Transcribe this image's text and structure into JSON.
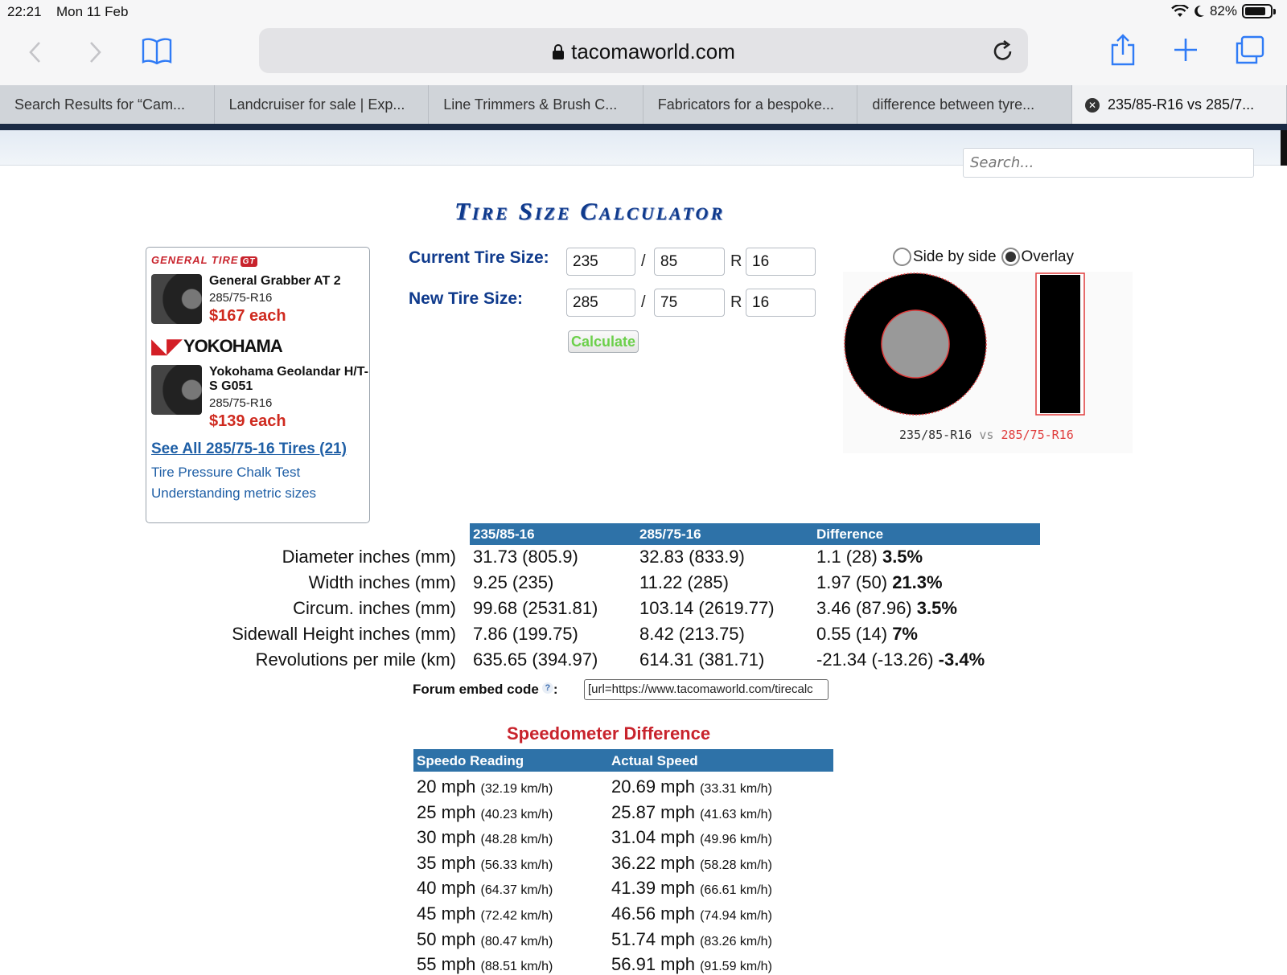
{
  "status": {
    "time": "22:21",
    "date": "Mon 11 Feb",
    "battery": "82%",
    "battery_level": 0.82
  },
  "toolbar": {
    "url": "tacomaworld.com",
    "back_icon": "chevron-left",
    "forward_icon": "chevron-right",
    "bookmarks_icon": "book",
    "share_icon": "share",
    "add_icon": "plus",
    "tabs_icon": "tabs",
    "reload_icon": "reload"
  },
  "tabs": [
    {
      "label": "Search Results for “Cam..."
    },
    {
      "label": "Landcruiser for sale | Exp..."
    },
    {
      "label": "Line Trimmers & Brush C..."
    },
    {
      "label": "Fabricators for a bespoke..."
    },
    {
      "label": "difference between tyre..."
    },
    {
      "label": "235/85-R16 vs 285/7..."
    }
  ],
  "search": {
    "placeholder": "Search..."
  },
  "page": {
    "title": "Tire Size Calculator"
  },
  "ad": {
    "brand1": "GENERAL TIRE",
    "brand1_badge": "GT",
    "tire1": {
      "name": "General Grabber AT 2",
      "size": "285/75-R16",
      "price": "$167 each"
    },
    "brand2": "YOKOHAMA",
    "tire2": {
      "name": "Yokohama Geolandar H/T-S G051",
      "size": "285/75-R16",
      "price": "$139 each"
    },
    "see_all": "See All 285/75-16 Tires (21)",
    "link1": "Tire Pressure Chalk Test",
    "link2": "Understanding metric sizes"
  },
  "form": {
    "current_label": "Current Tire Size:",
    "new_label": "New Tire Size:",
    "current": {
      "width": "235",
      "ratio": "85",
      "rim": "16"
    },
    "new": {
      "width": "285",
      "ratio": "75",
      "rim": "16"
    },
    "slash": "/",
    "r": "R",
    "calculate": "Calculate"
  },
  "viz": {
    "option1": "Side by side",
    "option2": "Overlay",
    "selected": "Overlay",
    "caption_a": "235/85-R16",
    "caption_vs": "vs",
    "caption_b": "285/75-R16"
  },
  "comparison": {
    "headers": [
      "235/85-16",
      "285/75-16",
      "Difference"
    ],
    "rows": [
      {
        "label": "Diameter inches (mm)",
        "a": "31.73 (805.9)",
        "b": "32.83 (833.9)",
        "diff": "1.1 (28)",
        "pct": "3.5%"
      },
      {
        "label": "Width inches (mm)",
        "a": "9.25 (235)",
        "b": "11.22 (285)",
        "diff": "1.97 (50)",
        "pct": "21.3%"
      },
      {
        "label": "Circum. inches (mm)",
        "a": "99.68 (2531.81)",
        "b": "103.14 (2619.77)",
        "diff": "3.46 (87.96)",
        "pct": "3.5%"
      },
      {
        "label": "Sidewall Height inches (mm)",
        "a": "7.86 (199.75)",
        "b": "8.42 (213.75)",
        "diff": "0.55 (14)",
        "pct": "7%"
      },
      {
        "label": "Revolutions per mile (km)",
        "a": "635.65 (394.97)",
        "b": "614.31 (381.71)",
        "diff": "-21.34 (-13.26)",
        "pct": "-3.4%"
      }
    ]
  },
  "embed": {
    "label": "Forum embed code",
    "help": "?",
    "colon": ":",
    "value": "[url=https://www.tacomaworld.com/tirecalc"
  },
  "speedo": {
    "title": "Speedometer Difference",
    "headers": [
      "Speedo Reading",
      "Actual Speed"
    ],
    "rows": [
      {
        "reading": "20 mph",
        "reading_kmh": "(32.19 km/h)",
        "actual": "20.69 mph",
        "actual_kmh": "(33.31 km/h)"
      },
      {
        "reading": "25 mph",
        "reading_kmh": "(40.23 km/h)",
        "actual": "25.87 mph",
        "actual_kmh": "(41.63 km/h)"
      },
      {
        "reading": "30 mph",
        "reading_kmh": "(48.28 km/h)",
        "actual": "31.04 mph",
        "actual_kmh": "(49.96 km/h)"
      },
      {
        "reading": "35 mph",
        "reading_kmh": "(56.33 km/h)",
        "actual": "36.22 mph",
        "actual_kmh": "(58.28 km/h)"
      },
      {
        "reading": "40 mph",
        "reading_kmh": "(64.37 km/h)",
        "actual": "41.39 mph",
        "actual_kmh": "(66.61 km/h)"
      },
      {
        "reading": "45 mph",
        "reading_kmh": "(72.42 km/h)",
        "actual": "46.56 mph",
        "actual_kmh": "(74.94 km/h)"
      },
      {
        "reading": "50 mph",
        "reading_kmh": "(80.47 km/h)",
        "actual": "51.74 mph",
        "actual_kmh": "(83.26 km/h)"
      },
      {
        "reading": "55 mph",
        "reading_kmh": "(88.51 km/h)",
        "actual": "56.91 mph",
        "actual_kmh": "(91.59 km/h)"
      }
    ]
  }
}
